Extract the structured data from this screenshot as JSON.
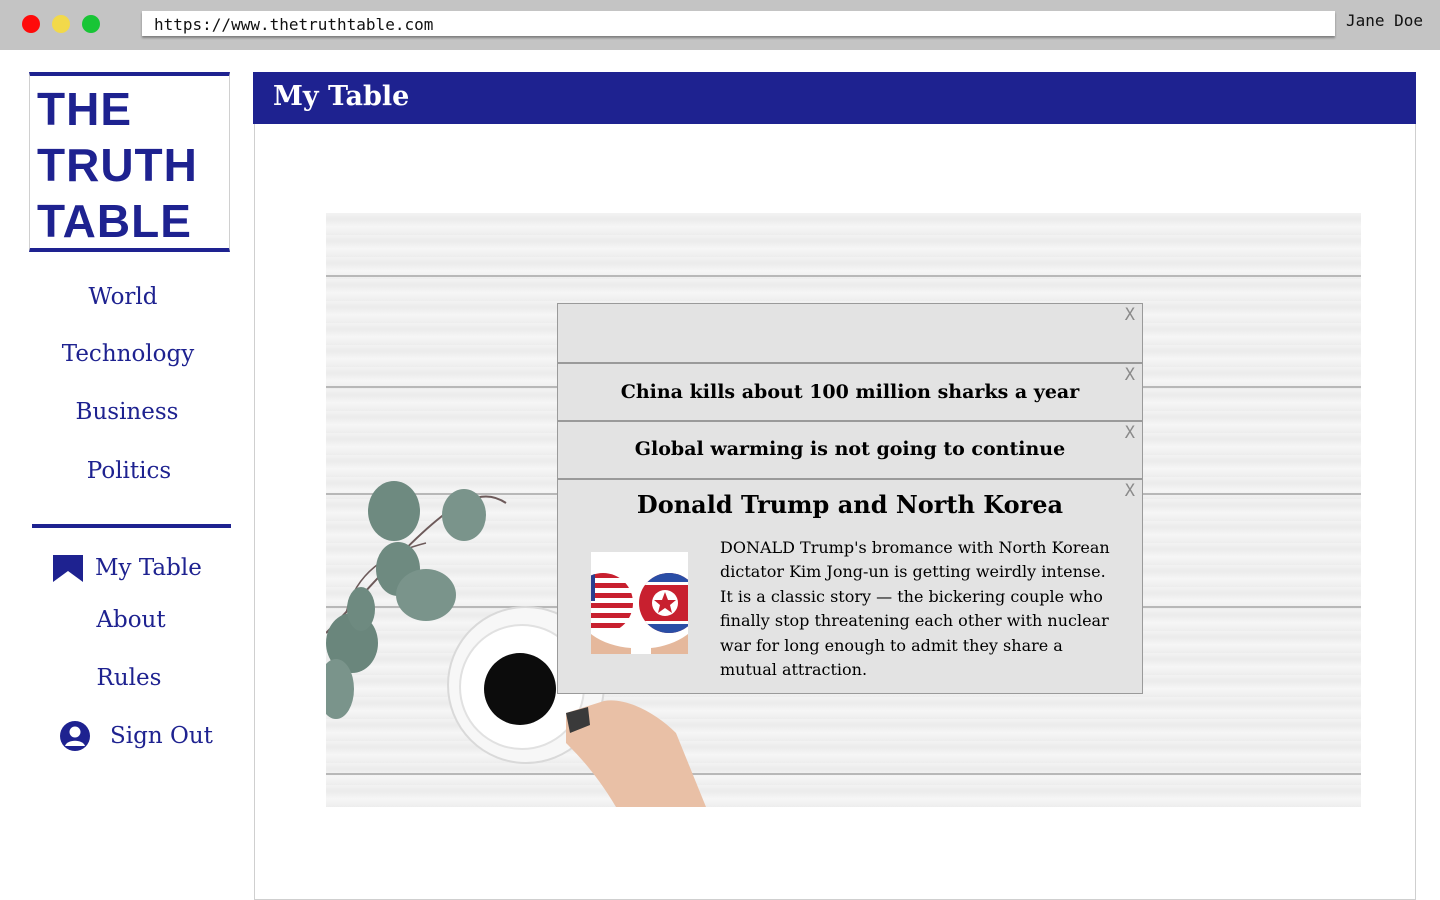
{
  "browser": {
    "url": "https://www.thetruthtable.com",
    "user": "Jane Doe"
  },
  "logo": {
    "line1": "THE",
    "line2": "TRUTH",
    "line3": "TABLE"
  },
  "sidebar": {
    "categories": [
      {
        "label": "World"
      },
      {
        "label": "Technology"
      },
      {
        "label": "Business"
      },
      {
        "label": "Politics"
      }
    ],
    "my_table": {
      "label": "My Table",
      "icon": "bookmark-icon"
    },
    "about": {
      "label": "About"
    },
    "rules": {
      "label": "Rules"
    },
    "sign_out": {
      "label": "Sign Out",
      "icon": "user-icon"
    }
  },
  "main": {
    "title": "My Table",
    "cards": [
      {
        "title": "",
        "close": "X"
      },
      {
        "title": "China kills about 100 million sharks a year",
        "close": "X"
      },
      {
        "title": "Global warming is not going to continue",
        "close": "X"
      },
      {
        "title": "Donald Trump and North Korea",
        "close": "X",
        "body": "DONALD Trump's bromance with North Korean dictator Kim Jong-un is getting weirdly intense. It is a classic story — the bickering couple who finally stop threatening each other with nuclear war for long enough to admit they share a mutual attraction.",
        "image": "us-north-korea-flags"
      }
    ]
  },
  "colors": {
    "brand": "#1e2290",
    "card_bg": "#e3e3e3",
    "chrome": "#c4c4c4"
  }
}
